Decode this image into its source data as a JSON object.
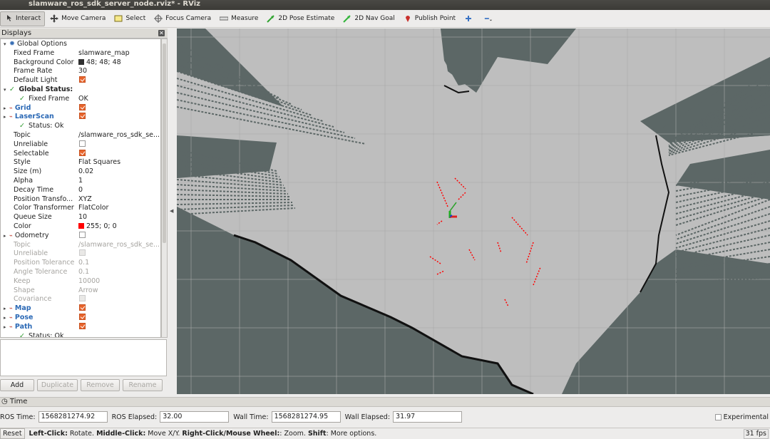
{
  "window": {
    "title": "slamware_ros_sdk_server_node.rviz* - RViz"
  },
  "toolbar": {
    "items": [
      {
        "label": "Interact",
        "icon": "interact-icon",
        "active": true
      },
      {
        "label": "Move Camera",
        "icon": "move-camera-icon"
      },
      {
        "label": "Select",
        "icon": "select-icon"
      },
      {
        "label": "Focus Camera",
        "icon": "focus-camera-icon"
      },
      {
        "label": "Measure",
        "icon": "measure-icon"
      },
      {
        "label": "2D Pose Estimate",
        "icon": "pose-estimate-icon"
      },
      {
        "label": "2D Nav Goal",
        "icon": "nav-goal-icon"
      },
      {
        "label": "Publish Point",
        "icon": "publish-point-icon"
      }
    ]
  },
  "displays": {
    "title": "Displays",
    "rows": [
      {
        "label": "Global Options",
        "value": "",
        "indent": 0,
        "kind": "options"
      },
      {
        "label": "Fixed Frame",
        "value": "slamware_map",
        "indent": 1
      },
      {
        "label": "Background Color",
        "value": "48; 48; 48",
        "indent": 1,
        "swatch": "#303030"
      },
      {
        "label": "Frame Rate",
        "value": "30",
        "indent": 1
      },
      {
        "label": "Default Light",
        "value": "",
        "indent": 1,
        "check": "on"
      },
      {
        "label": "Global Status: Ok",
        "value": "",
        "indent": 0,
        "kind": "status"
      },
      {
        "label": "Fixed Frame",
        "value": "OK",
        "indent": 1,
        "kind": "status"
      },
      {
        "label": "Grid",
        "value": "",
        "indent": 0,
        "kind": "display",
        "check": "on"
      },
      {
        "label": "LaserScan",
        "value": "",
        "indent": 0,
        "kind": "display",
        "check": "on"
      },
      {
        "label": "Status: Ok",
        "value": "",
        "indent": 1,
        "kind": "status"
      },
      {
        "label": "Topic",
        "value": "/slamware_ros_sdk_se...",
        "indent": 1
      },
      {
        "label": "Unreliable",
        "value": "",
        "indent": 1,
        "check": "off"
      },
      {
        "label": "Selectable",
        "value": "",
        "indent": 1,
        "check": "on"
      },
      {
        "label": "Style",
        "value": "Flat Squares",
        "indent": 1
      },
      {
        "label": "Size (m)",
        "value": "0.02",
        "indent": 1
      },
      {
        "label": "Alpha",
        "value": "1",
        "indent": 1
      },
      {
        "label": "Decay Time",
        "value": "0",
        "indent": 1
      },
      {
        "label": "Position Transfo...",
        "value": "XYZ",
        "indent": 1
      },
      {
        "label": "Color Transformer",
        "value": "FlatColor",
        "indent": 1
      },
      {
        "label": "Queue Size",
        "value": "10",
        "indent": 1
      },
      {
        "label": "Color",
        "value": "255; 0; 0",
        "indent": 1,
        "swatch": "#ff0000"
      },
      {
        "label": "Odometry",
        "value": "",
        "indent": 0,
        "kind": "display-plain",
        "check": "off"
      },
      {
        "label": "Topic",
        "value": "/slamware_ros_sdk_se...",
        "indent": 1,
        "dim": true
      },
      {
        "label": "Unreliable",
        "value": "",
        "indent": 1,
        "dim": true,
        "check": "dis"
      },
      {
        "label": "Position Tolerance",
        "value": "0.1",
        "indent": 1,
        "dim": true
      },
      {
        "label": "Angle Tolerance",
        "value": "0.1",
        "indent": 1,
        "dim": true
      },
      {
        "label": "Keep",
        "value": "10000",
        "indent": 1,
        "dim": true
      },
      {
        "label": "Shape",
        "value": "Arrow",
        "indent": 1,
        "dim": true
      },
      {
        "label": "Covariance",
        "value": "",
        "indent": 1,
        "dim": true,
        "check": "dis"
      },
      {
        "label": "Map",
        "value": "",
        "indent": 0,
        "kind": "display",
        "check": "on"
      },
      {
        "label": "Pose",
        "value": "",
        "indent": 0,
        "kind": "display",
        "check": "on"
      },
      {
        "label": "Path",
        "value": "",
        "indent": 0,
        "kind": "display",
        "check": "on"
      },
      {
        "label": "Status: Ok",
        "value": "",
        "indent": 1,
        "kind": "status"
      }
    ],
    "buttons": {
      "add": "Add",
      "duplicate": "Duplicate",
      "remove": "Remove",
      "rename": "Rename"
    }
  },
  "time_panel": {
    "title": "Time",
    "ros_time_label": "ROS Time:",
    "ros_time": "1568281274.92",
    "ros_elapsed_label": "ROS Elapsed:",
    "ros_elapsed": "32.00",
    "wall_time_label": "Wall Time:",
    "wall_time": "1568281274.95",
    "wall_elapsed_label": "Wall Elapsed:",
    "wall_elapsed": "31.97",
    "experimental_label": "Experimental"
  },
  "status": {
    "reset_label": "Reset",
    "hint_parts": [
      {
        "text": "Left-Click:",
        "bold": true
      },
      {
        "text": " Rotate. "
      },
      {
        "text": "Middle-Click:",
        "bold": true
      },
      {
        "text": " Move X/Y. "
      },
      {
        "text": "Right-Click/Mouse Wheel:",
        "bold": true
      },
      {
        "text": ": Zoom. "
      },
      {
        "text": "Shift",
        "bold": true
      },
      {
        "text": ": More options."
      }
    ],
    "fps": "31 fps"
  },
  "colors": {
    "map_unknown": "#5c6766",
    "map_free": "#bebebe",
    "grid": "#a9a9a9",
    "laser": "#ff0000"
  }
}
